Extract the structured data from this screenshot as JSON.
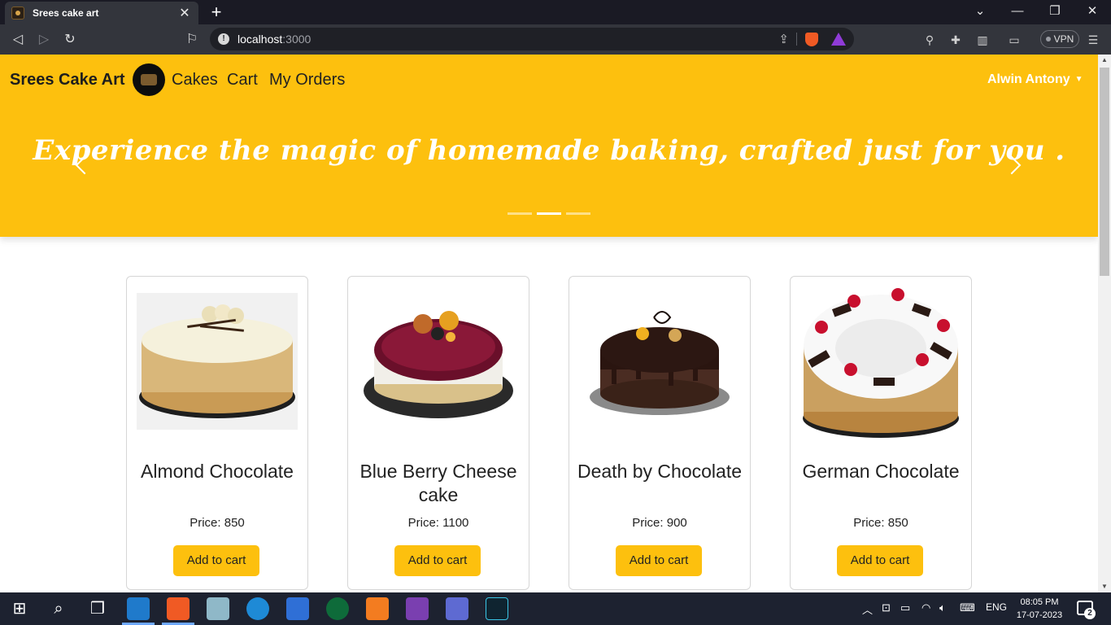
{
  "browser": {
    "tab_title": "Srees cake art",
    "url_host": "localhost",
    "url_port": ":3000",
    "vpn_label": "VPN"
  },
  "header": {
    "brand": "Srees Cake Art",
    "nav": [
      "Cakes",
      "Cart",
      "My Orders"
    ],
    "user_name": "Alwin Antony"
  },
  "hero": {
    "tagline": "Experience the magic of homemade baking, crafted just for you .",
    "slide_count": 3,
    "active_slide": 2
  },
  "products": [
    {
      "name": "Almond Chocolate",
      "price_text": "Price: 850",
      "button": "Add to cart",
      "image": "cream-almond-cake"
    },
    {
      "name": "Blue Berry Cheese cake",
      "price_text": "Price: 1100",
      "button": "Add to cart",
      "image": "blueberry-cheesecake"
    },
    {
      "name": "Death by Chocolate",
      "price_text": "Price: 900",
      "button": "Add to cart",
      "image": "chocolate-drip-cake"
    },
    {
      "name": "German Chocolate",
      "price_text": "Price: 850",
      "button": "Add to cart",
      "image": "black-forest-cake"
    }
  ],
  "taskbar": {
    "language": "ENG",
    "time": "08:05 PM",
    "date": "17-07-2023",
    "notification_count": "2"
  },
  "colors": {
    "accent_yellow": "#fdc00e",
    "browser_dark": "#1a1a24",
    "taskbar": "#1d2230"
  }
}
